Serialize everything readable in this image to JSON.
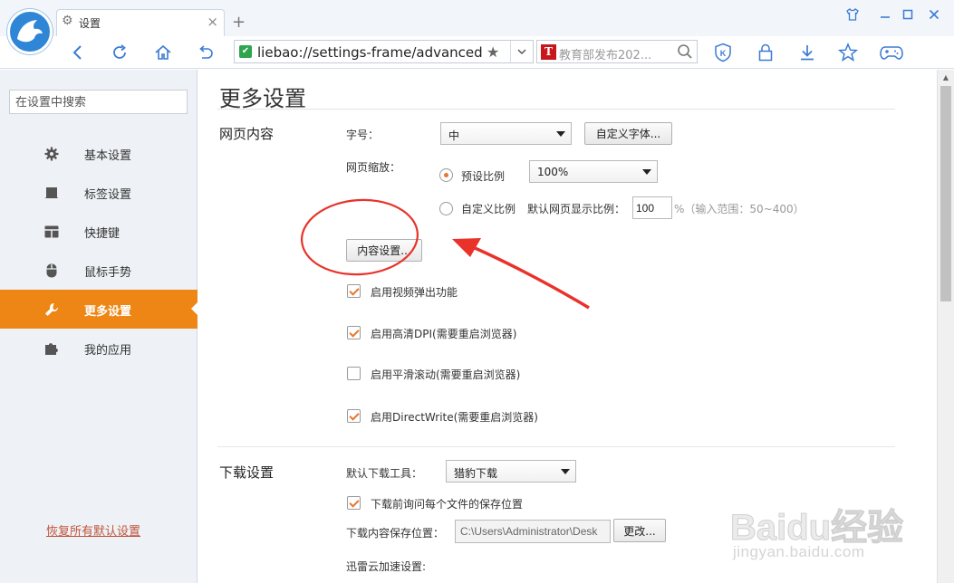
{
  "window": {
    "tab_title": "设置",
    "new_tab": "+",
    "close_tab": "×"
  },
  "toolbar": {
    "address": "liebao://settings-frame/advanced",
    "search_text": "教育部发布202..."
  },
  "sidebar": {
    "search_placeholder": "在设置中搜索",
    "items": [
      {
        "label": "基本设置",
        "icon": "gear-icon"
      },
      {
        "label": "标签设置",
        "icon": "tab-icon"
      },
      {
        "label": "快捷键",
        "icon": "shortcut-icon"
      },
      {
        "label": "鼠标手势",
        "icon": "mouse-icon"
      },
      {
        "label": "更多设置",
        "icon": "wrench-icon",
        "active": true
      },
      {
        "label": "我的应用",
        "icon": "puzzle-icon"
      }
    ],
    "restore_label": "恢复所有默认设置"
  },
  "main": {
    "title": "更多设置",
    "web_content": {
      "section_label": "网页内容",
      "font_size_label": "字号：",
      "font_size_value": "中",
      "custom_font_button": "自定义字体...",
      "zoom_label": "网页缩放：",
      "preset_label": "预设比例",
      "preset_value": "100%",
      "custom_label": "自定义比例",
      "default_zoom_label": "默认网页显示比例：",
      "zoom_input": "100",
      "zoom_hint": "%（输入范围：50~400）",
      "content_settings_button": "内容设置...",
      "checks": [
        {
          "label": "启用视频弹出功能",
          "checked": true
        },
        {
          "label": "启用高清DPI(需要重启浏览器)",
          "checked": true
        },
        {
          "label": "启用平滑滚动(需要重启浏览器)",
          "checked": false
        },
        {
          "label": "启用DirectWrite(需要重启浏览器)",
          "checked": true
        }
      ]
    },
    "download": {
      "section_label": "下载设置",
      "tool_label": "默认下载工具：",
      "tool_value": "猎豹下载",
      "ask_label": "下载前询问每个文件的保存位置",
      "ask_checked": true,
      "path_label": "下载内容保存位置：",
      "path_value": "C:\\Users\\Administrator\\Desk",
      "change_button": "更改...",
      "xunlei_label": "迅雷云加速设置:"
    }
  },
  "colors": {
    "accent": "#ee8615",
    "annotation": "#e8322a"
  },
  "watermark": {
    "logo": "Baidu经验",
    "url": "jingyan.baidu.com"
  }
}
